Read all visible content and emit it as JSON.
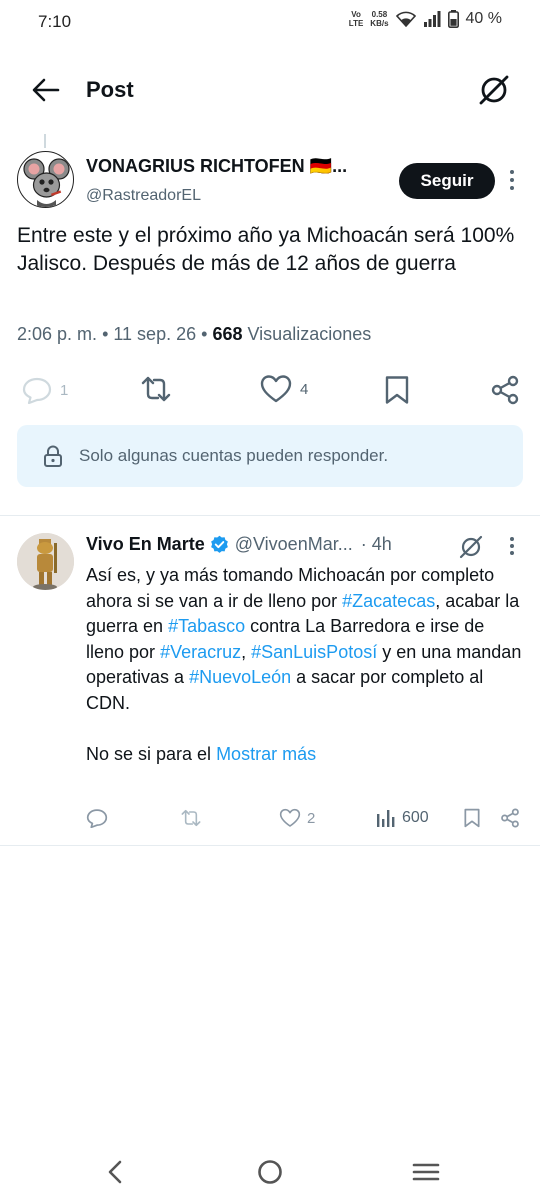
{
  "status_bar": {
    "time": "7:10",
    "volte_line1": "Vo",
    "volte_line2": "LTE",
    "speed_value": "0.58",
    "speed_unit": "KB/s",
    "battery": "40 %"
  },
  "header": {
    "title": "Post"
  },
  "main_tweet": {
    "display_name": "VONAGRIUS RICHTOFEN 🇩🇪...",
    "username": "@RastreadorEL",
    "follow_label": "Seguir",
    "text": "Entre este y el próximo año ya Michoacán será 100% Jalisco. Después de más de 12 años de guerra",
    "time": "2:06 p. m.",
    "date": "11 sep. 26",
    "views_count": "668",
    "views_label": "Visualizaciones",
    "reply_count": "1",
    "like_count": "4",
    "reply_restriction": "Solo algunas cuentas pueden responder."
  },
  "reply_tweet": {
    "display_name": "Vivo En Marte",
    "username": "@VivoenMar...",
    "time": "· 4h",
    "text_1": "Así es, y ya más tomando Michoacán por completo ahora si se van a ir de lleno por ",
    "hashtag_1": "#Zacatecas",
    "text_2": ", acabar la guerra en ",
    "hashtag_2": "#Tabasco",
    "text_3": " contra La Barredora e irse de lleno por ",
    "hashtag_3": "#Veracruz",
    "text_4": ", ",
    "hashtag_4": "#SanLuisPotosí",
    "text_5": " y en una mandan operativas a ",
    "hashtag_5": "#NuevoLeón",
    "text_6": " a sacar por completo al CDN.",
    "text_7": "No se si para el ",
    "show_more": "Mostrar más",
    "like_count": "2",
    "views_count": "600"
  },
  "colors": {
    "accent": "#1d9bf0",
    "text_primary": "#0f1419",
    "text_secondary": "#536471",
    "restriction_bg": "#e8f5fd"
  }
}
